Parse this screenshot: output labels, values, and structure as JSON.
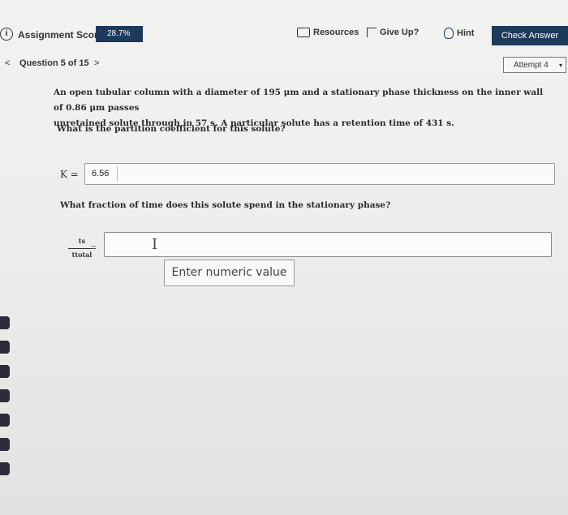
{
  "header": {
    "assignment_score_label": "Assignment Score:",
    "assignment_score_value": "28.7%",
    "resources_label": "Resources",
    "give_up_label": "Give Up?",
    "hint_label": "Hint",
    "check_answer_label": "Check Answer"
  },
  "nav": {
    "prev_glyph": "<",
    "question_label": "Question 5 of 15",
    "next_glyph": ">",
    "attempt_label": "Attempt 4",
    "attempt_caret": "▾"
  },
  "question": {
    "text_line1": "An open tubular column with a diameter of 195 μm and a stationary phase thickness on the inner wall of 0.86 μm passes",
    "text_line2": "unretained solute through in 57 s. A particular solute has a retention time of 431 s.",
    "prompt": "What is the partition coefficient for this solute?"
  },
  "part1": {
    "label": "K =",
    "value": "6.56"
  },
  "part2": {
    "prompt": "What fraction of time does this solute spend in the stationary phase?",
    "numerator": "ts",
    "denominator": "ttotal",
    "equals": "=",
    "value": "",
    "tooltip": "Enter numeric value"
  },
  "icons": {
    "info": "info-circle-icon",
    "resources": "resources-icon",
    "give_up": "give-up-icon",
    "hint": "hint-icon"
  },
  "colors": {
    "header_dark": "#1e3a5a"
  }
}
